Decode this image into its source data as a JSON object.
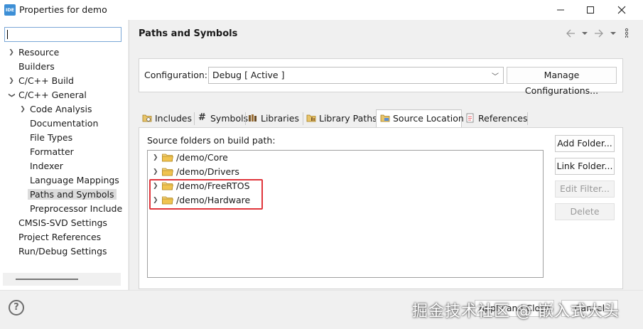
{
  "window": {
    "app_icon_text": "IDE",
    "title": "Properties for demo",
    "controls": [
      "minimize-icon",
      "maximize-icon",
      "close-icon"
    ]
  },
  "sidebar": {
    "filter_value": "",
    "items": [
      {
        "label": "Resource",
        "expander": "collapsed"
      },
      {
        "label": "Builders",
        "expander": "none"
      },
      {
        "label": "C/C++ Build",
        "expander": "collapsed"
      },
      {
        "label": "C/C++ General",
        "expander": "expanded"
      },
      {
        "label": "Code Analysis",
        "expander": "collapsed"
      },
      {
        "label": "Documentation",
        "expander": "none"
      },
      {
        "label": "File Types",
        "expander": "none"
      },
      {
        "label": "Formatter",
        "expander": "none"
      },
      {
        "label": "Indexer",
        "expander": "none"
      },
      {
        "label": "Language Mappings",
        "expander": "none"
      },
      {
        "label": "Paths and Symbols",
        "expander": "none",
        "selected": true
      },
      {
        "label": "Preprocessor Include",
        "expander": "none"
      },
      {
        "label": "CMSIS-SVD Settings",
        "expander": "none"
      },
      {
        "label": "Project References",
        "expander": "none"
      },
      {
        "label": "Run/Debug Settings",
        "expander": "none"
      }
    ]
  },
  "header": {
    "title": "Paths and Symbols",
    "nav_icons": [
      "back-arrow-icon",
      "dropdown-icon",
      "forward-arrow-icon",
      "dropdown-icon",
      "menu-dots-icon"
    ]
  },
  "configuration": {
    "label": "Configuration:",
    "value": "Debug  [ Active ]",
    "manage_button": "Manage Configurations..."
  },
  "tabs": [
    {
      "label": "Includes",
      "icon": "includes-icon"
    },
    {
      "label": "Symbols",
      "icon": "hash-icon"
    },
    {
      "label": "Libraries",
      "icon": "libraries-icon"
    },
    {
      "label": "Library Paths",
      "icon": "library-paths-icon"
    },
    {
      "label": "Source Location",
      "icon": "source-folder-icon",
      "active": true
    },
    {
      "label": "References",
      "icon": "references-icon"
    }
  ],
  "source_location": {
    "label": "Source folders on build path:",
    "folders": [
      "/demo/Core",
      "/demo/Drivers",
      "/demo/FreeRTOS",
      "/demo/Hardware"
    ],
    "highlighted": [
      "/demo/FreeRTOS",
      "/demo/Hardware"
    ],
    "highlight_color": "#e0353b",
    "buttons": {
      "add_folder": "Add Folder...",
      "link_folder": "Link Folder...",
      "edit_filter": "Edit Filter...",
      "delete": "Delete"
    }
  },
  "footer": {
    "help_label": "?",
    "apply_close": "Apply and Close",
    "cancel": "Cancel",
    "watermark": "掘金技术社区 @ 嵌入式大头"
  }
}
